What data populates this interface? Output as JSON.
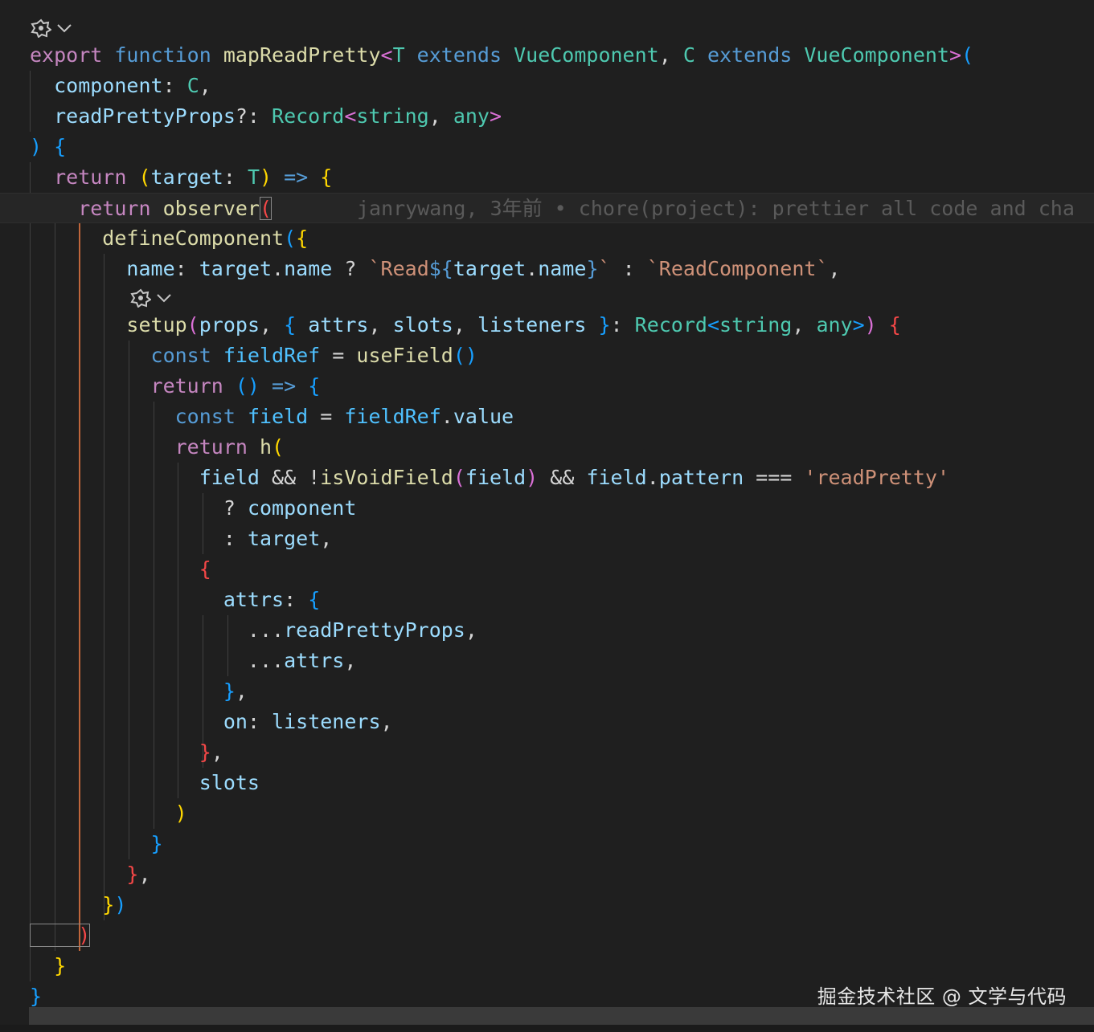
{
  "colors": {
    "keyword_blue": "#569cd6",
    "control_purple": "#c586c0",
    "function_yellow": "#dcdcaa",
    "variable": "#9cdcfe",
    "type_teal": "#4ec9b0",
    "string": "#ce9178",
    "bracket_gold": "#ffd700",
    "bracket_pink": "#da70d6",
    "bracket_blue": "#179fff",
    "punct": "#d4d4d4",
    "error_red": "#f44747",
    "blame": "#5a5a5a"
  },
  "codelens_icons": [
    "copilot-icon",
    "chevron-down-icon"
  ],
  "blame": {
    "text": "janrywang, 3年前 • chore(project): prettier all code and cha"
  },
  "code_lines": [
    [
      [
        "export ",
        "#c586c0"
      ],
      [
        "function ",
        "#569cd6"
      ],
      [
        "mapReadPretty",
        "#dcdcaa"
      ],
      [
        "<",
        "#da70d6"
      ],
      [
        "T",
        "#4ec9b0"
      ],
      [
        " extends ",
        "#569cd6"
      ],
      [
        "VueComponent",
        "#4ec9b0"
      ],
      [
        ", ",
        "#d4d4d4"
      ],
      [
        "C",
        "#4ec9b0"
      ],
      [
        " extends ",
        "#569cd6"
      ],
      [
        "VueComponent",
        "#4ec9b0"
      ],
      [
        ">",
        "#da70d6"
      ],
      [
        "(",
        "#179fff"
      ]
    ],
    [
      [
        "  component",
        "#9cdcfe"
      ],
      [
        ": ",
        "#d4d4d4"
      ],
      [
        "C",
        "#4ec9b0"
      ],
      [
        ",",
        "#d4d4d4"
      ]
    ],
    [
      [
        "  readPrettyProps",
        "#9cdcfe"
      ],
      [
        "?: ",
        "#d4d4d4"
      ],
      [
        "Record",
        "#4ec9b0"
      ],
      [
        "<",
        "#da70d6"
      ],
      [
        "string",
        "#4ec9b0"
      ],
      [
        ", ",
        "#d4d4d4"
      ],
      [
        "any",
        "#4ec9b0"
      ],
      [
        ">",
        "#da70d6"
      ]
    ],
    [
      [
        ") ",
        "#179fff"
      ],
      [
        "{",
        "#179fff"
      ]
    ],
    [
      [
        "  return ",
        "#c586c0"
      ],
      [
        "(",
        "#ffd700"
      ],
      [
        "target",
        "#9cdcfe"
      ],
      [
        ": ",
        "#d4d4d4"
      ],
      [
        "T",
        "#4ec9b0"
      ],
      [
        ")",
        "#ffd700"
      ],
      [
        " => ",
        "#569cd6"
      ],
      [
        "{",
        "#ffd700"
      ]
    ],
    [
      [
        "    return ",
        "#c586c0"
      ],
      [
        "observer",
        "#dcdcaa"
      ],
      [
        "(",
        "#f44747"
      ]
    ],
    [
      [
        "      defineComponent",
        "#dcdcaa"
      ],
      [
        "(",
        "#179fff"
      ],
      [
        "{",
        "#ffd700"
      ]
    ],
    [
      [
        "        name",
        "#9cdcfe"
      ],
      [
        ": ",
        "#d4d4d4"
      ],
      [
        "target",
        "#9cdcfe"
      ],
      [
        ".",
        "#d4d4d4"
      ],
      [
        "name",
        "#9cdcfe"
      ],
      [
        " ? ",
        "#d4d4d4"
      ],
      [
        "`Read",
        "#ce9178"
      ],
      [
        "${",
        "#569cd6"
      ],
      [
        "target",
        "#9cdcfe"
      ],
      [
        ".",
        "#d4d4d4"
      ],
      [
        "name",
        "#9cdcfe"
      ],
      [
        "}",
        "#569cd6"
      ],
      [
        "`",
        "#ce9178"
      ],
      [
        " : ",
        "#d4d4d4"
      ],
      [
        "`ReadComponent`",
        "#ce9178"
      ],
      [
        ",",
        "#d4d4d4"
      ]
    ],
    [
      [
        "        setup",
        "#dcdcaa"
      ],
      [
        "(",
        "#da70d6"
      ],
      [
        "props",
        "#9cdcfe"
      ],
      [
        ", ",
        "#d4d4d4"
      ],
      [
        "{ ",
        "#179fff"
      ],
      [
        "attrs",
        "#9cdcfe"
      ],
      [
        ", ",
        "#d4d4d4"
      ],
      [
        "slots",
        "#9cdcfe"
      ],
      [
        ", ",
        "#d4d4d4"
      ],
      [
        "listeners",
        "#9cdcfe"
      ],
      [
        " }",
        "#179fff"
      ],
      [
        ": ",
        "#d4d4d4"
      ],
      [
        "Record",
        "#4ec9b0"
      ],
      [
        "<",
        "#179fff"
      ],
      [
        "string",
        "#4ec9b0"
      ],
      [
        ", ",
        "#d4d4d4"
      ],
      [
        "any",
        "#4ec9b0"
      ],
      [
        ">",
        "#179fff"
      ],
      [
        ")",
        "#da70d6"
      ],
      [
        " {",
        "#f44747"
      ]
    ],
    [
      [
        "          const ",
        "#569cd6"
      ],
      [
        "fieldRef",
        "#4fc1ff"
      ],
      [
        " = ",
        "#d4d4d4"
      ],
      [
        "useField",
        "#dcdcaa"
      ],
      [
        "()",
        "#179fff"
      ]
    ],
    [
      [
        "          return ",
        "#c586c0"
      ],
      [
        "() ",
        "#179fff"
      ],
      [
        "=> ",
        "#569cd6"
      ],
      [
        "{",
        "#179fff"
      ]
    ],
    [
      [
        "            const ",
        "#569cd6"
      ],
      [
        "field",
        "#4fc1ff"
      ],
      [
        " = ",
        "#d4d4d4"
      ],
      [
        "fieldRef",
        "#4fc1ff"
      ],
      [
        ".",
        "#d4d4d4"
      ],
      [
        "value",
        "#9cdcfe"
      ]
    ],
    [
      [
        "            return ",
        "#c586c0"
      ],
      [
        "h",
        "#dcdcaa"
      ],
      [
        "(",
        "#ffd700"
      ]
    ],
    [
      [
        "              field",
        "#9cdcfe"
      ],
      [
        " && !",
        "#d4d4d4"
      ],
      [
        "isVoidField",
        "#dcdcaa"
      ],
      [
        "(",
        "#da70d6"
      ],
      [
        "field",
        "#9cdcfe"
      ],
      [
        ")",
        "#da70d6"
      ],
      [
        " && ",
        "#d4d4d4"
      ],
      [
        "field",
        "#9cdcfe"
      ],
      [
        ".",
        "#d4d4d4"
      ],
      [
        "pattern",
        "#9cdcfe"
      ],
      [
        " === ",
        "#d4d4d4"
      ],
      [
        "'readPretty'",
        "#ce9178"
      ]
    ],
    [
      [
        "                ? ",
        "#d4d4d4"
      ],
      [
        "component",
        "#9cdcfe"
      ]
    ],
    [
      [
        "                : ",
        "#d4d4d4"
      ],
      [
        "target",
        "#9cdcfe"
      ],
      [
        ",",
        "#d4d4d4"
      ]
    ],
    [
      [
        "              {",
        "#f44747"
      ]
    ],
    [
      [
        "                attrs",
        "#9cdcfe"
      ],
      [
        ": ",
        "#d4d4d4"
      ],
      [
        "{",
        "#179fff"
      ]
    ],
    [
      [
        "                  ...",
        "#d4d4d4"
      ],
      [
        "readPrettyProps",
        "#9cdcfe"
      ],
      [
        ",",
        "#d4d4d4"
      ]
    ],
    [
      [
        "                  ...",
        "#d4d4d4"
      ],
      [
        "attrs",
        "#9cdcfe"
      ],
      [
        ",",
        "#d4d4d4"
      ]
    ],
    [
      [
        "                }",
        "#179fff"
      ],
      [
        ",",
        "#d4d4d4"
      ]
    ],
    [
      [
        "                on",
        "#9cdcfe"
      ],
      [
        ": ",
        "#d4d4d4"
      ],
      [
        "listeners",
        "#9cdcfe"
      ],
      [
        ",",
        "#d4d4d4"
      ]
    ],
    [
      [
        "              }",
        "#f44747"
      ],
      [
        ",",
        "#d4d4d4"
      ]
    ],
    [
      [
        "              slots",
        "#9cdcfe"
      ]
    ],
    [
      [
        "            )",
        "#ffd700"
      ]
    ],
    [
      [
        "          }",
        "#179fff"
      ]
    ],
    [
      [
        "        }",
        "#f44747"
      ],
      [
        ",",
        "#d4d4d4"
      ]
    ],
    [
      [
        "      }",
        "#ffd700"
      ],
      [
        ")",
        "#179fff"
      ]
    ],
    [
      [
        "    )",
        "#f44747"
      ]
    ],
    [
      [
        "  }",
        "#ffd700"
      ]
    ],
    [
      [
        "}",
        "#179fff"
      ]
    ]
  ],
  "watermark": "掘金技术社区 @ 文学与代码"
}
